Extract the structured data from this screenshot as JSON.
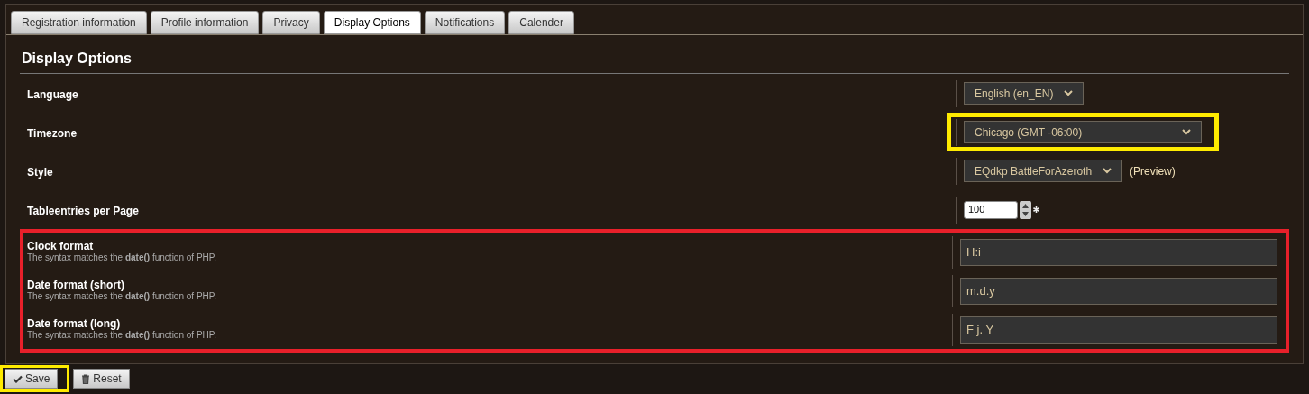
{
  "tabs": [
    {
      "label": "Registration information",
      "selected": false
    },
    {
      "label": "Profile information",
      "selected": false
    },
    {
      "label": "Privacy",
      "selected": false
    },
    {
      "label": "Display Options",
      "selected": true
    },
    {
      "label": "Notifications",
      "selected": false
    },
    {
      "label": "Calender",
      "selected": false
    }
  ],
  "heading": "Display Options",
  "settings": [
    {
      "label": "Language",
      "kind": "select",
      "value": "English (en_EN)",
      "highlight": false
    },
    {
      "label": "Timezone",
      "kind": "select",
      "value": "Chicago (GMT -06:00)",
      "highlight": true
    },
    {
      "label": "Style",
      "kind": "select",
      "value": "EQdkp BattleForAzeroth",
      "link": "(Preview)",
      "highlight": false
    },
    {
      "label": "Tableentries per Page",
      "kind": "number",
      "value": "100",
      "required": true,
      "highlight": false
    }
  ],
  "formats": {
    "highlight": true,
    "items": [
      {
        "label": "Clock format",
        "description": "The syntax matches the **date()** function of PHP.",
        "value": "H:i"
      },
      {
        "label": "Date format (short)",
        "description": "The syntax matches the **date()** function of PHP.",
        "value": "m.d.y"
      },
      {
        "label": "Date format (long)",
        "description": "The syntax matches the **date()** function of PHP.",
        "value": "F j. Y"
      }
    ]
  },
  "buttons": [
    {
      "label": "Save",
      "kind": "save",
      "highlight": true
    },
    {
      "label": "Reset",
      "kind": "reset",
      "highlight": false
    }
  ]
}
